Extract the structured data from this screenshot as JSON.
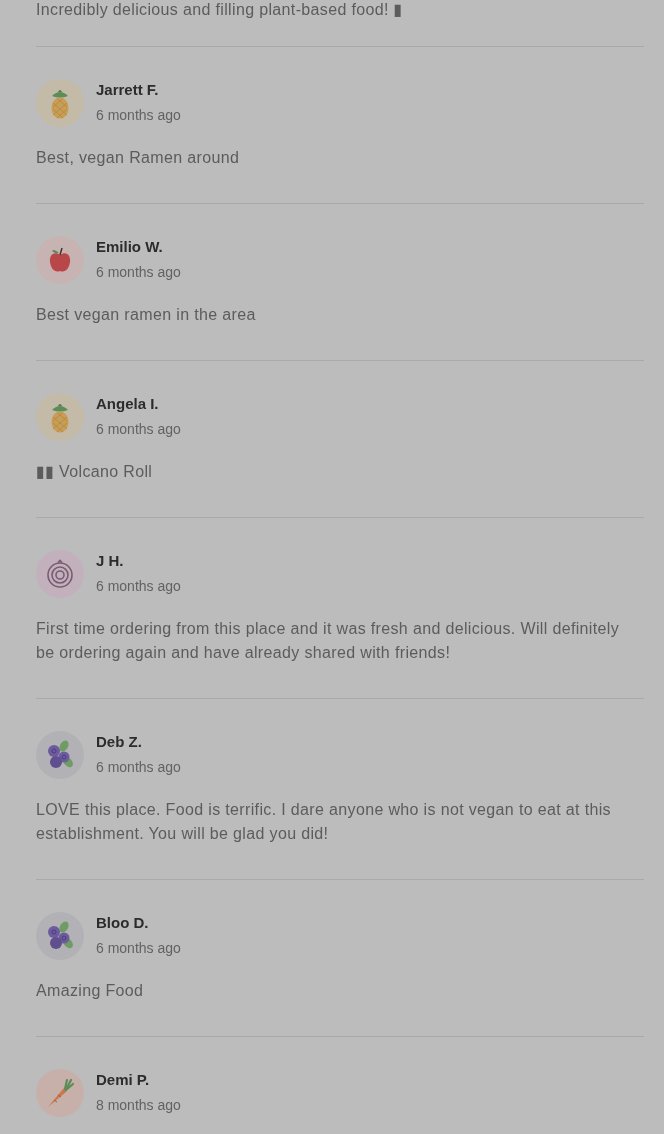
{
  "previous_review": {
    "text": "Incredibly delicious and filling plant-based food! ▮"
  },
  "reviews": [
    {
      "avatar": {
        "kind": "pineapple"
      },
      "name": "Jarrett F.",
      "time": "6 months ago",
      "text": "Best, vegan Ramen around"
    },
    {
      "avatar": {
        "kind": "apple"
      },
      "name": "Emilio W.",
      "time": "6 months ago",
      "text": "Best vegan ramen in the area"
    },
    {
      "avatar": {
        "kind": "pineapple"
      },
      "name": "Angela I.",
      "time": "6 months ago",
      "text": "▮▮ Volcano Roll"
    },
    {
      "avatar": {
        "kind": "onion"
      },
      "name": "J H.",
      "time": "6 months ago",
      "text": "First time ordering from this place and it was fresh and delicious. Will definitely be ordering again and have already shared with friends!"
    },
    {
      "avatar": {
        "kind": "blueberries"
      },
      "name": "Deb Z.",
      "time": "6 months ago",
      "text": "LOVE this place. Food is terrific. I dare anyone who is not vegan to eat at this establishment. You will be glad you did!"
    },
    {
      "avatar": {
        "kind": "blueberries"
      },
      "name": "Bloo D.",
      "time": "6 months ago",
      "text": "Amazing Food"
    },
    {
      "avatar": {
        "kind": "carrot"
      },
      "name": "Demi P.",
      "time": "8 months ago"
    }
  ]
}
